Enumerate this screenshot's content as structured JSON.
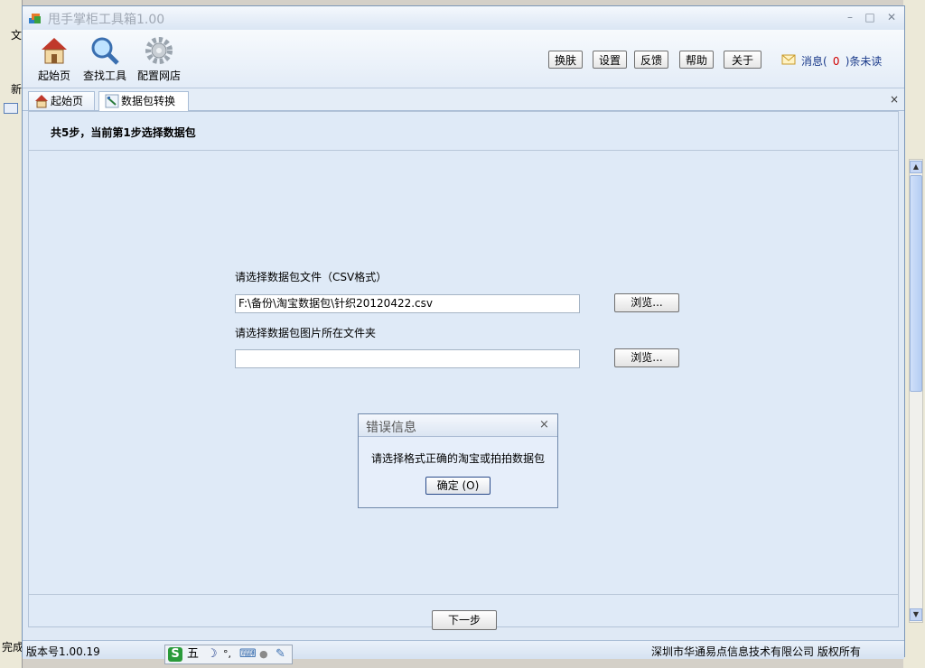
{
  "window": {
    "title": "甩手掌柜工具箱1.00",
    "minimize": "–",
    "maximize": "□",
    "close": "✕"
  },
  "background": {
    "left_menu_char": "文",
    "left_new_char": "新",
    "left_done": "完成"
  },
  "toolbar": {
    "tools": [
      {
        "label": "起始页",
        "icon": "home-icon"
      },
      {
        "label": "查找工具",
        "icon": "magnifier-icon"
      },
      {
        "label": "配置网店",
        "icon": "gear-icon"
      }
    ],
    "buttons": [
      "换肤",
      "设置",
      "反馈",
      "帮助",
      "关于"
    ],
    "message_prefix": "消息(",
    "message_count": "0",
    "message_suffix": ")条未读"
  },
  "tabs": [
    {
      "label": "起始页",
      "icon": "home-icon",
      "active": false
    },
    {
      "label": "数据包转换",
      "icon": "convert-icon",
      "active": true
    }
  ],
  "tab_close": "×",
  "wizard": {
    "steps_text": "共5步，当前第1步选择数据包",
    "csv_label": "请选择数据包文件（CSV格式）",
    "csv_value": "F:\\备份\\淘宝数据包\\针织20120422.csv",
    "browse_label": "浏览...",
    "image_folder_label": "请选择数据包图片所在文件夹",
    "image_folder_value": "",
    "next_label": "下一步"
  },
  "dialog": {
    "title": "错误信息",
    "close": "×",
    "message": "请选择格式正确的淘宝或拍拍数据包",
    "ok_label": "确定 (O)"
  },
  "status": {
    "version": "版本号1.00.19",
    "copyright": "深圳市华通易点信息技术有限公司  版权所有"
  },
  "ime": {
    "logo": "S",
    "mode": "五",
    "moon": "☽",
    "punct": "°,",
    "keyboard": "⌨",
    "user": "●",
    "tool": "✎"
  },
  "colors": {
    "accent": "#1a3a8a",
    "message_count": "#d00000",
    "panel_bg": "#dfeaf7"
  }
}
